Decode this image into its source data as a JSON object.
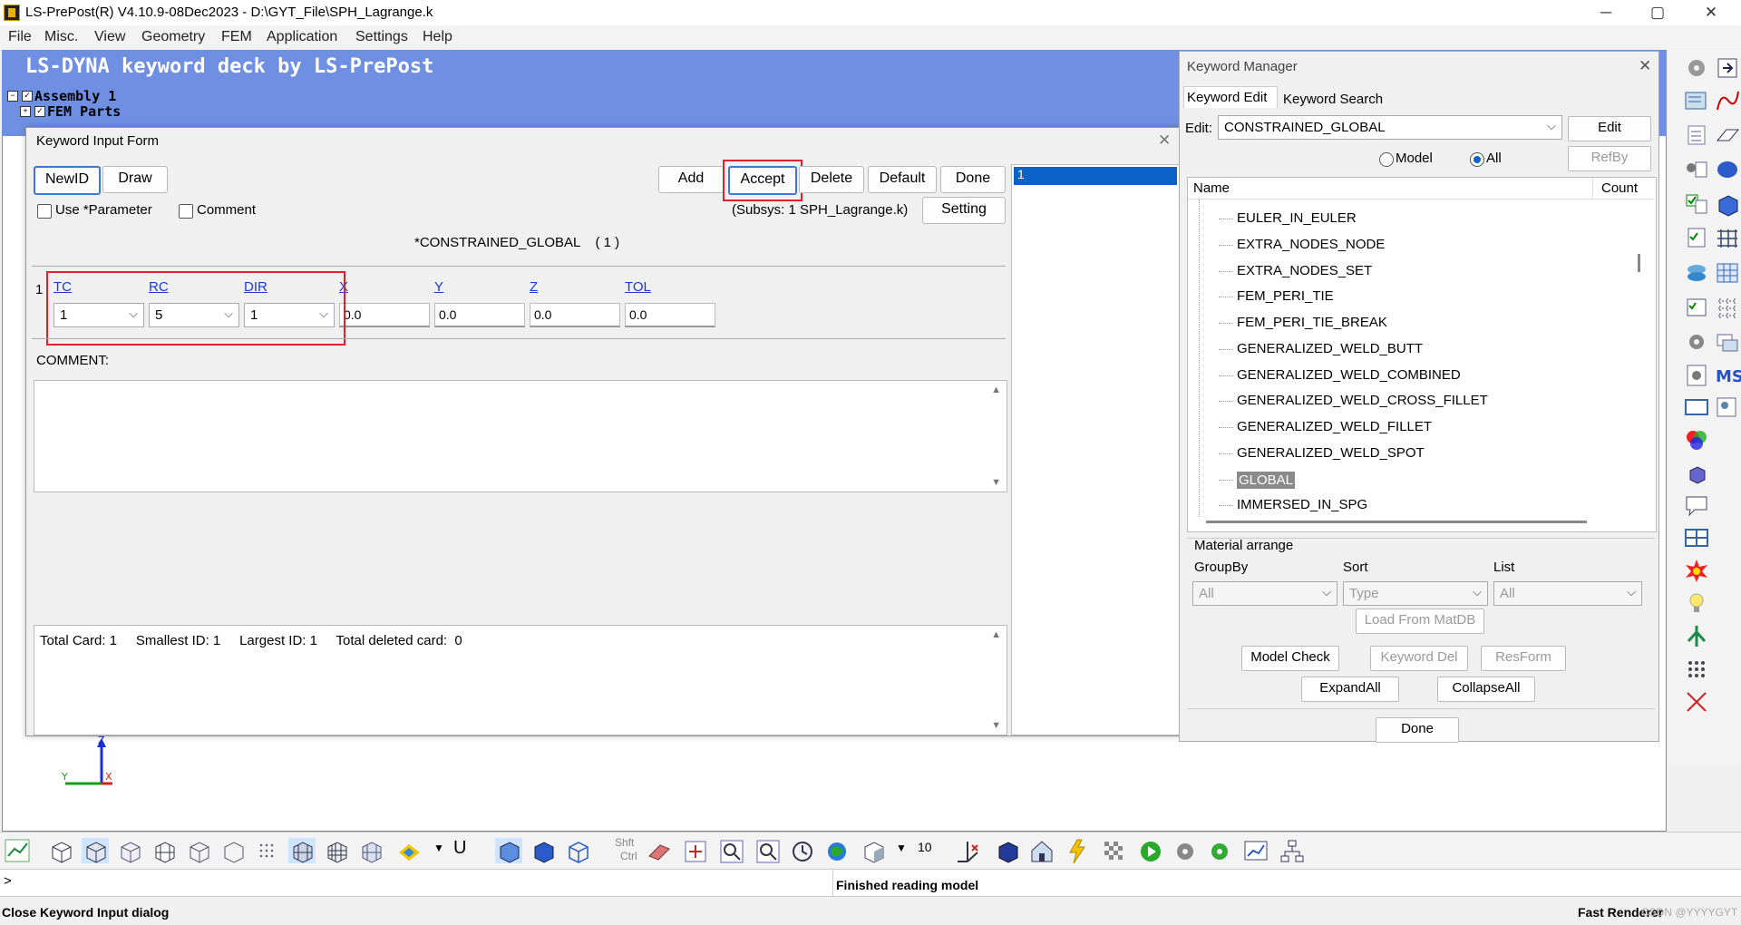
{
  "window": {
    "title": "LS-PrePost(R) V4.10.9-08Dec2023 - D:\\GYT_File\\SPH_Lagrange.k",
    "min": "─",
    "max": "▢",
    "close": "✕"
  },
  "menu": [
    "File",
    "Misc.",
    "View",
    "Geometry",
    "FEM",
    "Application",
    "Settings",
    "Help"
  ],
  "viewport": {
    "deck_title": "LS-DYNA keyword deck by LS-PrePost",
    "tree_assembly": "Assembly 1",
    "tree_parts": "FEM Parts"
  },
  "kif": {
    "title": "Keyword Input Form",
    "close": "✕",
    "buttons": {
      "newid": "NewID",
      "draw": "Draw",
      "add": "Add",
      "accept": "Accept",
      "delete": "Delete",
      "default": "Default",
      "done": "Done",
      "setting": "Setting"
    },
    "use_parameter": "Use *Parameter",
    "comment_chk": "Comment",
    "subsys": "(Subsys: 1 SPH_Lagrange.k)",
    "keyword_header": "*CONSTRAINED_GLOBAL    ( 1 )",
    "row_index": "1",
    "fields": [
      {
        "name": "TC",
        "value": "1",
        "type": "combo"
      },
      {
        "name": "RC",
        "value": "5",
        "type": "combo"
      },
      {
        "name": "DIR",
        "value": "1",
        "type": "combo"
      },
      {
        "name": "X",
        "value": "0.0",
        "type": "text"
      },
      {
        "name": "Y",
        "value": "0.0",
        "type": "text"
      },
      {
        "name": "Z",
        "value": "0.0",
        "type": "text"
      },
      {
        "name": "TOL",
        "value": "0.0",
        "type": "text"
      }
    ],
    "comment_label": "COMMENT:",
    "summary": "Total Card: 1     Smallest ID: 1     Largest ID: 1     Total deleted card:  0",
    "id_list": [
      "1"
    ]
  },
  "km": {
    "title": "Keyword Manager",
    "close": "✕",
    "tabs": [
      "Keyword Edit",
      "Keyword Search"
    ],
    "edit_label": "Edit:",
    "edit_value": "CONSTRAINED_GLOBAL",
    "edit_btn": "Edit",
    "radio_model": "Model",
    "radio_all": "All",
    "refby": "RefBy",
    "col_name": "Name",
    "col_count": "Count",
    "items": [
      "EULER_IN_EULER",
      "EXTRA_NODES_NODE",
      "EXTRA_NODES_SET",
      "FEM_PERI_TIE",
      "FEM_PERI_TIE_BREAK",
      "GENERALIZED_WELD_BUTT",
      "GENERALIZED_WELD_COMBINED",
      "GENERALIZED_WELD_CROSS_FILLET",
      "GENERALIZED_WELD_FILLET",
      "GENERALIZED_WELD_SPOT",
      "GLOBAL",
      "IMMERSED_IN_SPG"
    ],
    "material_arrange": "Material arrange",
    "groupby_label": "GroupBy",
    "groupby_value": "All",
    "sort_label": "Sort",
    "sort_value": "Type",
    "list_label": "List",
    "list_value": "All",
    "load_matdb": "Load From MatDB",
    "model_check": "Model Check",
    "keyword_del": "Keyword Del",
    "resform": "ResForm",
    "expand_all": "ExpandAll",
    "collapse_all": "CollapseAll",
    "done": "Done"
  },
  "toolbar": {
    "shft": "Shft",
    "ctrl": "Ctrl",
    "num": "10",
    "u_label": "U"
  },
  "cmdline": {
    "prompt": ">",
    "message": "Finished reading model"
  },
  "status": {
    "left": "Close Keyword Input dialog",
    "right": "Fast Renderer",
    "watermark": "CSDN @YYYYGYT"
  },
  "colors": {
    "accent": "#0a64c8",
    "highlight_red": "#e0202a",
    "viewport_blue": "#6f8fe2"
  }
}
